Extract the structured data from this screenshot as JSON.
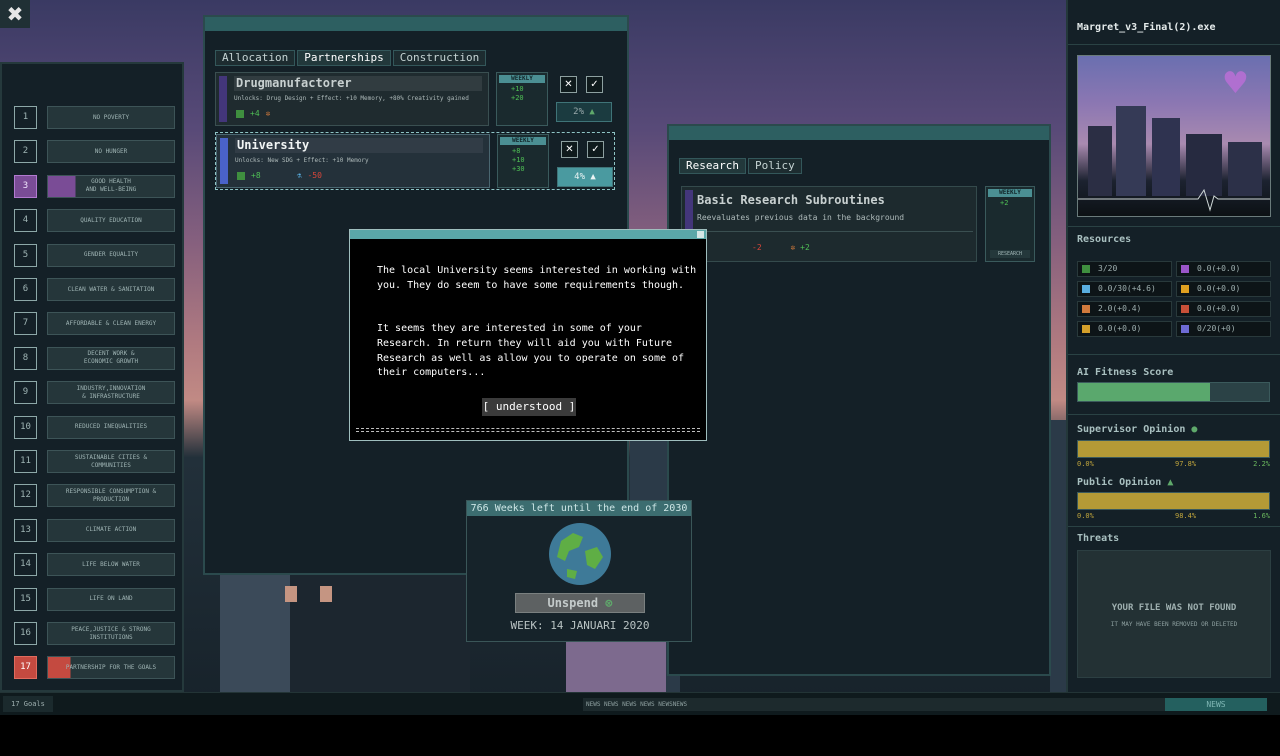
{
  "window": {
    "close_icon": "close-x-icon"
  },
  "goals": {
    "items": [
      {
        "num": "1",
        "label": "NO POVERTY"
      },
      {
        "num": "2",
        "label": "NO HUNGER"
      },
      {
        "num": "3",
        "label": "GOOD HEALTH\nAND WELL-BEING",
        "state": "active"
      },
      {
        "num": "4",
        "label": "QUALITY EDUCATION"
      },
      {
        "num": "5",
        "label": "GENDER EQUALITY"
      },
      {
        "num": "6",
        "label": "CLEAN WATER & SANITATION"
      },
      {
        "num": "7",
        "label": "AFFORDABLE & CLEAN ENERGY"
      },
      {
        "num": "8",
        "label": "DECENT WORK &\nECONOMIC GROWTH"
      },
      {
        "num": "9",
        "label": "INDUSTRY,INNOVATION\n& INFRASTRUCTURE"
      },
      {
        "num": "10",
        "label": "REDUCED INEQUALITIES"
      },
      {
        "num": "11",
        "label": "SUSTAINABLE CITIES &\nCOMMUNITIES"
      },
      {
        "num": "12",
        "label": "RESPONSIBLE CONSUMPTION &\nPRODUCTION"
      },
      {
        "num": "13",
        "label": "CLIMATE ACTION"
      },
      {
        "num": "14",
        "label": "LIFE BELOW WATER"
      },
      {
        "num": "15",
        "label": "LIFE ON LAND"
      },
      {
        "num": "16",
        "label": "PEACE,JUSTICE & STRONG\nINSTITUTIONS"
      },
      {
        "num": "17",
        "label": "PARTNERSHIP FOR THE GOALS",
        "state": "red"
      }
    ]
  },
  "partners": {
    "tabs": [
      "Allocation",
      "Partnerships",
      "Construction"
    ],
    "active_tab": 1,
    "cards": [
      {
        "title": "Drugmanufactorer",
        "desc": "Unlocks: Drug Design + Effect: +10 Memory, +80% Creativity gained",
        "bottom_a": "+4",
        "bottom_b": "",
        "week_label": "WEEKLY",
        "weekly": [
          "",
          "+10",
          "+20"
        ],
        "accept": "✓",
        "reject": "✕",
        "pct": "2%"
      },
      {
        "title": "University",
        "desc": "Unlocks: New SDG + Effect: +10 Memory",
        "bottom_a": "+8",
        "bottom_b": "-50",
        "week_label": "WEEKLY",
        "weekly": [
          "+8",
          "+10",
          "+30"
        ],
        "accept": "✓",
        "reject": "✕",
        "pct": "4%"
      }
    ]
  },
  "research": {
    "tabs": [
      "Research",
      "Policy"
    ],
    "active_tab": 0,
    "card": {
      "title": "Basic Research Subroutines",
      "desc": "Reevaluates previous data in the background",
      "bottom_r": "-2",
      "bottom_g": "+2",
      "week_label": "WEEKLY",
      "weekly": "+2",
      "button": "RESEARCH"
    }
  },
  "dialog": {
    "text1": "The local University seems interested in working with you. They do seem to have some requirements though.",
    "text2": "It seems they are interested in some of your Research. In return they will aid you with Future Research as well as allow you to operate on some of their computers...",
    "button": "[ understood ]"
  },
  "timer": {
    "header": "766 Weeks left until the end of 2030",
    "unspend": "Unspend",
    "week": "WEEK: 14 JANUARI 2020"
  },
  "sidebar": {
    "title": "Margret_v3_Final(2).exe",
    "resources_label": "Resources",
    "resources": [
      {
        "icon": "memory-icon",
        "value": "3/20",
        "color": "#3f8f3f"
      },
      {
        "icon": "star-icon",
        "value": "0.0(+0.0)",
        "color": "#9a55c8"
      },
      {
        "icon": "flask-icon",
        "value": "0.0/30(+4.6)",
        "color": "#59aee0"
      },
      {
        "icon": "energy-icon",
        "value": "0.0(+0.0)",
        "color": "#e0a020"
      },
      {
        "icon": "bug-icon",
        "value": "2.0(+0.4)",
        "color": "#d17a3c"
      },
      {
        "icon": "block-icon",
        "value": "0.0(+0.0)",
        "color": "#c85038"
      },
      {
        "icon": "coin-icon",
        "value": "0.0(+0.0)",
        "color": "#d5a02a"
      },
      {
        "icon": "virus-icon",
        "value": "0/20(+0)",
        "color": "#6e6bd4"
      }
    ],
    "fitness_label": "AI Fitness Score",
    "fitness_value": 0.69,
    "supervisor_label": "Supervisor Opinion",
    "supervisor": {
      "neg": "0.0%",
      "mid": "97.8%",
      "pos": "2.2%"
    },
    "public_label": "Public Opinion",
    "public": {
      "neg": "0.0%",
      "mid": "98.4%",
      "pos": "1.6%"
    },
    "threats_label": "Threats",
    "threats_title": "YOUR FILE WAS NOT FOUND",
    "threats_sub": "IT MAY HAVE BEEN REMOVED OR DELETED"
  },
  "bottom": {
    "goal_count": "17 Goals",
    "ticker": "NEWS NEWS NEWS NEWS NEWSNEWS",
    "news": "NEWS"
  }
}
